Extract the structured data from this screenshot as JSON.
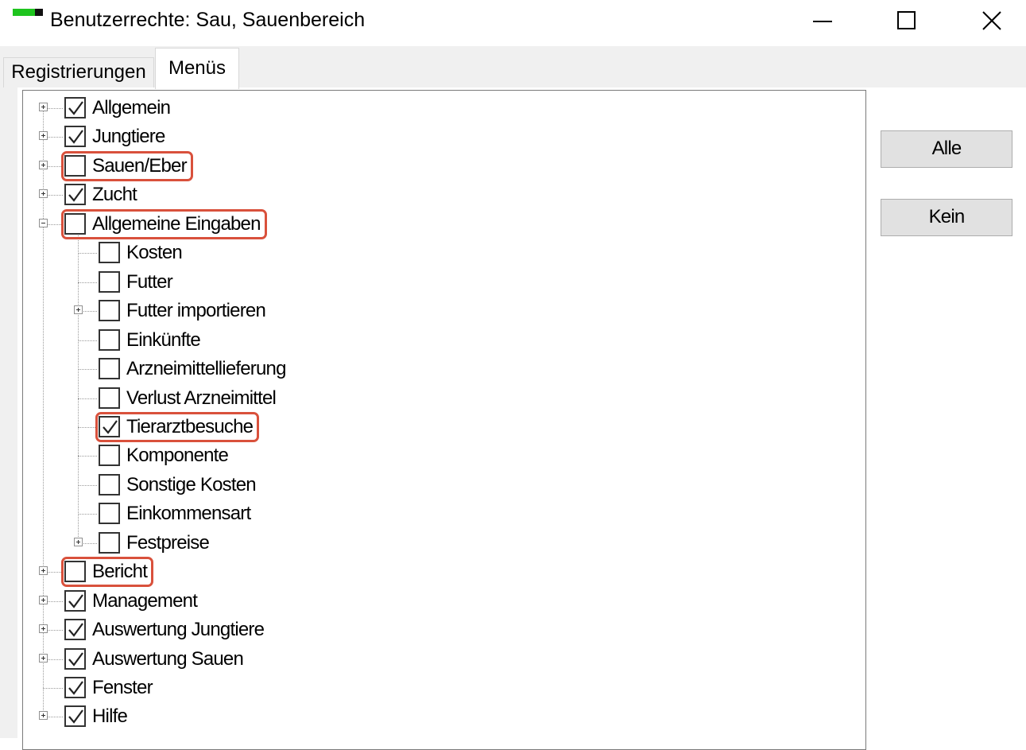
{
  "window": {
    "title": "Benutzerrechte: Sau, Sauenbereich",
    "icon": "app-icon",
    "controls": [
      "minimize-icon",
      "maximize-icon",
      "close-icon"
    ]
  },
  "tabs": [
    {
      "label": "Registrierungen",
      "active": false
    },
    {
      "label": "Menüs",
      "active": true
    }
  ],
  "tree": [
    {
      "label": "Allgemein",
      "checked": true,
      "level": 0,
      "expander": "plus",
      "highlight": false
    },
    {
      "label": "Jungtiere",
      "checked": true,
      "level": 0,
      "expander": "plus",
      "highlight": false
    },
    {
      "label": "Sauen/Eber",
      "checked": false,
      "level": 0,
      "expander": "plus",
      "highlight": true
    },
    {
      "label": "Zucht",
      "checked": true,
      "level": 0,
      "expander": "plus",
      "highlight": false
    },
    {
      "label": "Allgemeine Eingaben",
      "checked": false,
      "level": 0,
      "expander": "minus",
      "highlight": true
    },
    {
      "label": "Kosten",
      "checked": false,
      "level": 1,
      "expander": "none",
      "highlight": false
    },
    {
      "label": "Futter",
      "checked": false,
      "level": 1,
      "expander": "none",
      "highlight": false
    },
    {
      "label": "Futter importieren",
      "checked": false,
      "level": 1,
      "expander": "plus",
      "highlight": false
    },
    {
      "label": "Einkünfte",
      "checked": false,
      "level": 1,
      "expander": "none",
      "highlight": false
    },
    {
      "label": "Arzneimittellieferung",
      "checked": false,
      "level": 1,
      "expander": "none",
      "highlight": false
    },
    {
      "label": "Verlust Arzneimittel",
      "checked": false,
      "level": 1,
      "expander": "none",
      "highlight": false
    },
    {
      "label": "Tierarztbesuche",
      "checked": true,
      "level": 1,
      "expander": "none",
      "highlight": true
    },
    {
      "label": "Komponente",
      "checked": false,
      "level": 1,
      "expander": "none",
      "highlight": false
    },
    {
      "label": "Sonstige Kosten",
      "checked": false,
      "level": 1,
      "expander": "none",
      "highlight": false
    },
    {
      "label": "Einkommensart",
      "checked": false,
      "level": 1,
      "expander": "none",
      "highlight": false
    },
    {
      "label": "Festpreise",
      "checked": false,
      "level": 1,
      "expander": "plus",
      "highlight": false
    },
    {
      "label": "Bericht",
      "checked": false,
      "level": 0,
      "expander": "plus",
      "highlight": true
    },
    {
      "label": "Management",
      "checked": true,
      "level": 0,
      "expander": "plus",
      "highlight": false
    },
    {
      "label": "Auswertung Jungtiere",
      "checked": true,
      "level": 0,
      "expander": "plus",
      "highlight": false
    },
    {
      "label": "Auswertung Sauen",
      "checked": true,
      "level": 0,
      "expander": "plus",
      "highlight": false
    },
    {
      "label": "Fenster",
      "checked": true,
      "level": 0,
      "expander": "none",
      "highlight": false
    },
    {
      "label": "Hilfe",
      "checked": true,
      "level": 0,
      "expander": "plus",
      "highlight": false
    }
  ],
  "buttons": {
    "all": "Alle",
    "none": "Kein"
  },
  "colors": {
    "highlight": "#d9513c",
    "icon_green": "#1ec41e",
    "button_face": "#e1e1e1",
    "dialog_bg": "#f0f0f0"
  }
}
